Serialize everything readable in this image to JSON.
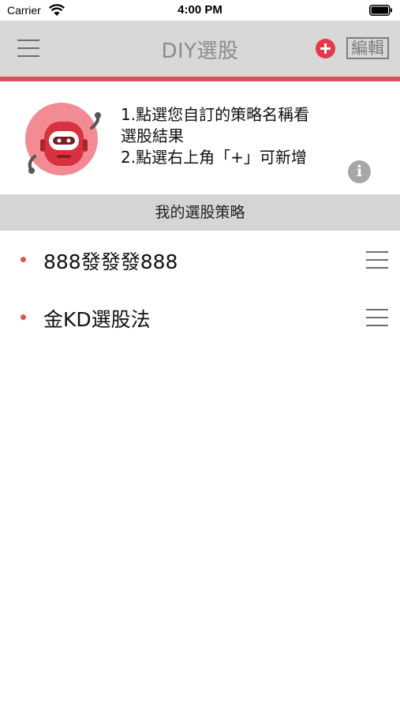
{
  "status_bar": {
    "carrier": "Carrier",
    "time": "4:00 PM",
    "icons": [
      "wifi-icon",
      "battery-icon"
    ]
  },
  "nav": {
    "title": "DIY選股",
    "menu_icon": "hamburger-menu-icon",
    "add_icon": "plus-circle-icon",
    "edit_label": "編輯",
    "accent_color": "#d9545a",
    "add_color": "#e5394a"
  },
  "info": {
    "mascot_icon": "robot-mascot-icon",
    "line1": "1.點選您自訂的策略名稱看",
    "line2": "選股結果",
    "line3": "2.點選右上角「+」可新增",
    "info_icon": "info-icon"
  },
  "section": {
    "title": "我的選股策略"
  },
  "strategies": [
    {
      "label": "888發發發888"
    },
    {
      "label": "金KD選股法"
    }
  ],
  "colors": {
    "nav_background": "#d8d8d8",
    "section_background": "#d5d5d5",
    "bullet": "#d9545a"
  }
}
